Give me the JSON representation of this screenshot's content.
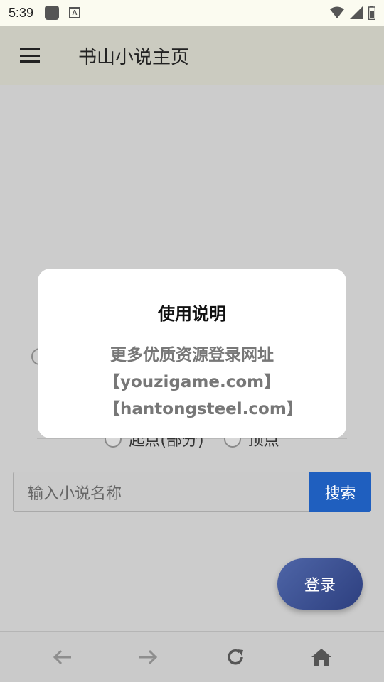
{
  "status_bar": {
    "time": "5:39",
    "notif_letter": "A"
  },
  "app_bar": {
    "title": "书山小说主页"
  },
  "radio_options": [
    {
      "label": "起点(部分)"
    },
    {
      "label": "顶点"
    }
  ],
  "search": {
    "placeholder": "输入小说名称",
    "button_label": "搜索"
  },
  "login": {
    "label": "登录"
  },
  "dialog": {
    "title": "使用说明",
    "line1": "更多优质资源登录网址",
    "line2": "【youzigame.com】",
    "line3": "【hantongsteel.com】"
  },
  "colors": {
    "accent": "#1f5fbf",
    "fab": "#3d5294",
    "dialog_text": "#777777"
  },
  "nav_icons": [
    "back-arrow-icon",
    "forward-arrow-icon",
    "reload-icon",
    "home-icon"
  ]
}
